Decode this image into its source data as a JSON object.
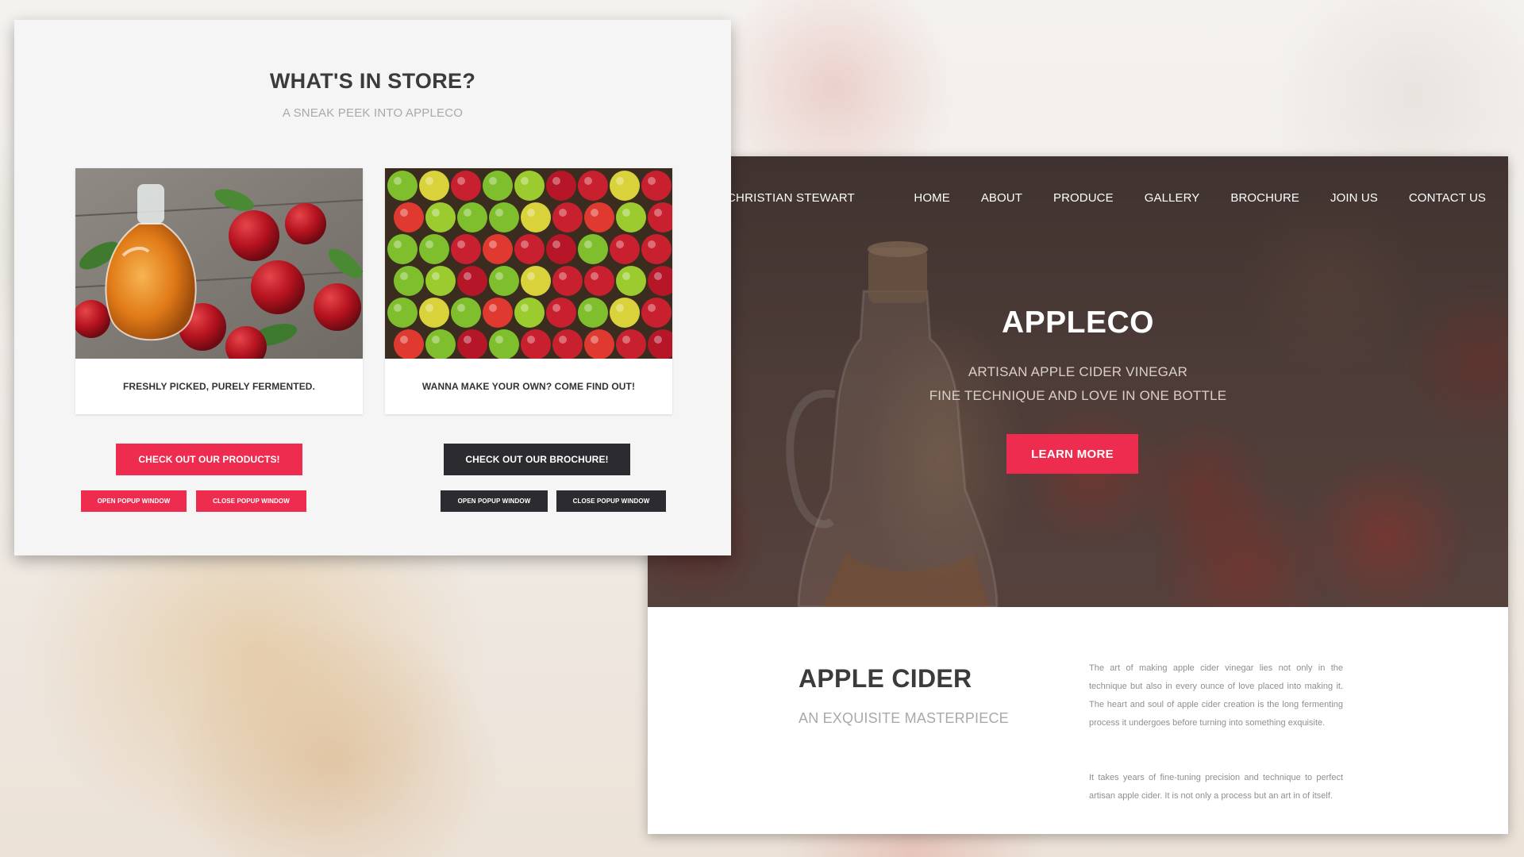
{
  "website": {
    "brand": "CHRISTIAN STEWART",
    "nav": [
      "HOME",
      "ABOUT",
      "PRODUCE",
      "GALLERY",
      "BROCHURE",
      "JOIN US",
      "CONTACT US"
    ],
    "hero": {
      "title": "APPLECO",
      "subtitle_line1": "ARTISAN APPLE CIDER VINEGAR",
      "subtitle_line2": "FINE TECHNIQUE AND LOVE IN ONE BOTTLE",
      "button": "LEARN MORE"
    },
    "about": {
      "title": "APPLE CIDER",
      "subtitle": "AN EXQUISITE MASTERPIECE",
      "paragraph1": "The art of making apple cider vinegar lies not only in the technique but also in every ounce of love placed into making it. The heart and soul of apple cider creation is the long fermenting process it undergoes before turning into something exquisite.",
      "paragraph2": "It takes years of fine-tuning precision and technique to perfect artisan apple cider. It is not only a process but an art in of itself."
    }
  },
  "popup": {
    "title": "WHAT'S IN STORE?",
    "subtitle": "A SNEAK PEEK INTO APPLECO",
    "cards": [
      {
        "caption": "FRESHLY PICKED, PURELY FERMENTED."
      },
      {
        "caption": "WANNA MAKE YOUR OWN? COME FIND OUT!"
      }
    ],
    "buttons": {
      "products": "CHECK OUT OUR PRODUCTS!",
      "brochure": "CHECK OUT OUR BROCHURE!",
      "open_popup": "OPEN POPUP WINDOW",
      "close_popup": "CLOSE POPUP WINDOW"
    }
  },
  "colors": {
    "accent_pink": "#ee2c4f",
    "dark_button": "#2b2b30",
    "panel_bg": "#f5f5f5",
    "heading_text": "#3b3b3b"
  }
}
